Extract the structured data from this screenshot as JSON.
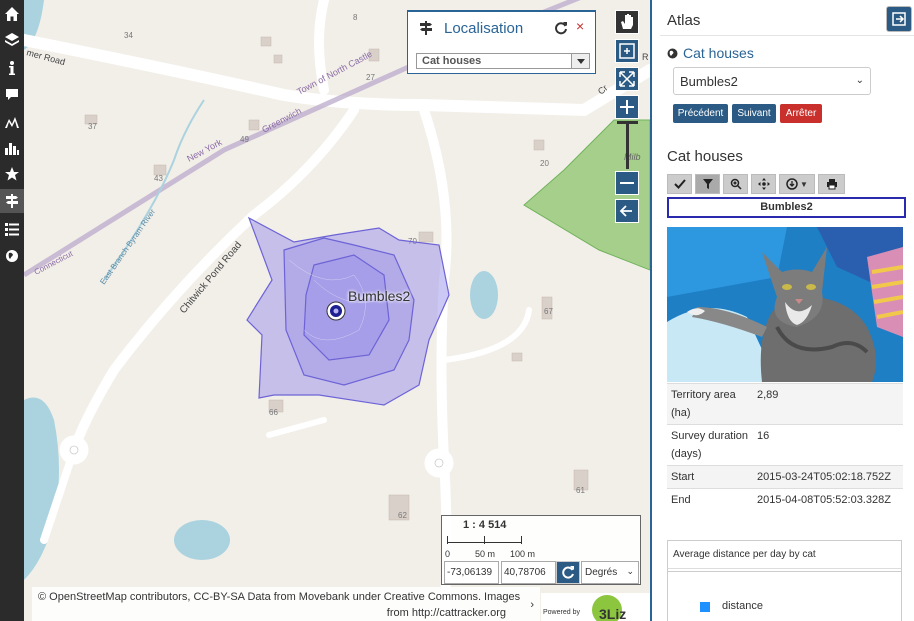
{
  "left_toolbar": {
    "items": [
      "home-icon",
      "layers-icon",
      "info-icon",
      "comment-icon",
      "elevation-icon",
      "chart-icon",
      "star-icon",
      "signpost-icon",
      "list-icon",
      "globe-icon"
    ]
  },
  "map": {
    "road_labels": [
      "mer Road",
      "Town of North Castle",
      "Greenwich",
      "New York",
      "East Branch Byram River",
      "Connecticut",
      "Chitwick Pond Road",
      "Milb",
      "Cr",
      "R"
    ],
    "house_numbers": [
      "34",
      "8",
      "27",
      "37",
      "49",
      "20",
      "43",
      "70",
      "67",
      "66",
      "61",
      "62"
    ],
    "feature_label": "Bumbles2",
    "colors": {
      "territory": "#8f86e8",
      "park": "#a7cf8c",
      "water": "#aad3df"
    }
  },
  "localisation": {
    "title": "Localisation",
    "selected": "Cat houses",
    "close": "×"
  },
  "scale": {
    "ratio": "1 : 4 514",
    "labels": [
      "0",
      "50 m",
      "100 m"
    ]
  },
  "coords": {
    "x": "-73,06139",
    "y": "40,78706",
    "unit": "Degrés"
  },
  "attribution": {
    "line1": "© OpenStreetMap contributors, CC-BY-SA Data from Movebank under Creative Commons. Images",
    "line2": "from http://cattracker.org",
    "chevron": "›"
  },
  "powered": {
    "label": "Powered by",
    "logo_text": "3Liz"
  },
  "atlas": {
    "title": "Atlas",
    "layer": "Cat houses",
    "selected_feature": "Bumbles2",
    "buttons": {
      "prev": "Précédent",
      "next": "Suivant",
      "stop": "Arrêter"
    },
    "section_title": "Cat houses",
    "feature_name": "Bumbles2",
    "attributes": [
      {
        "key": "Territory area (ha)",
        "value": "2,89"
      },
      {
        "key": "Survey duration (days)",
        "value": "16"
      },
      {
        "key": "Start",
        "value": "2015-03-24T05:02:18.752Z"
      },
      {
        "key": "End",
        "value": "2015-04-08T05:52:03.328Z"
      }
    ],
    "chart_title": "Average distance per day by cat",
    "legend": "distance",
    "accent": "#2b5b84",
    "danger": "#c9302c"
  }
}
